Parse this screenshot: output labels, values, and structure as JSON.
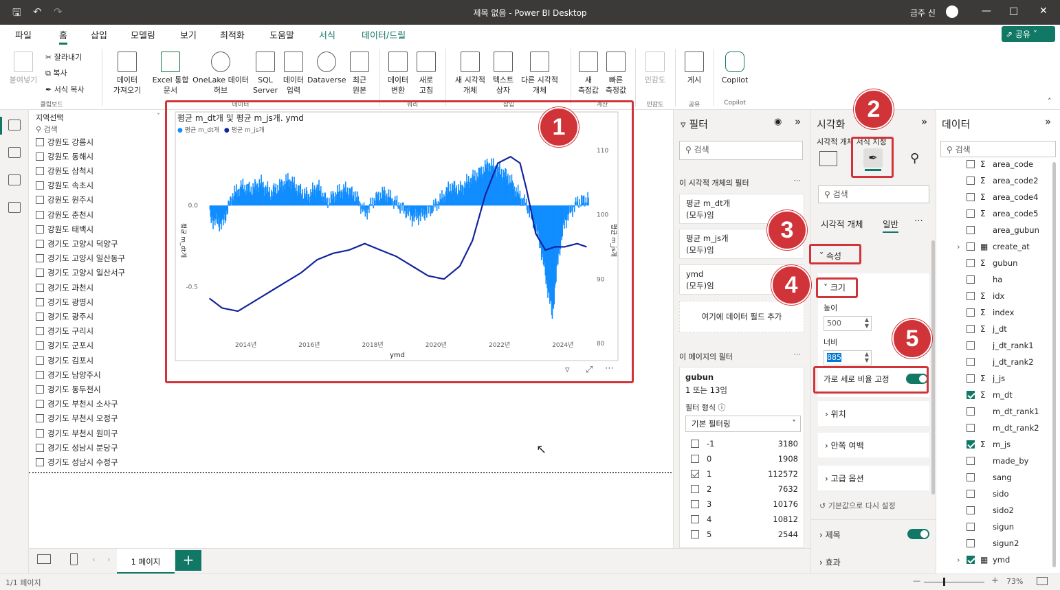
{
  "window": {
    "title": "제목 없음 - Power BI Desktop",
    "user": "금주 신"
  },
  "menu": {
    "tabs": [
      "파일",
      "홈",
      "삽입",
      "모델링",
      "보기",
      "최적화",
      "도움말",
      "서식",
      "데이터/드릴"
    ],
    "active": "홈",
    "share": "공유"
  },
  "ribbon": {
    "clipboard": {
      "paste": "붙여넣기",
      "cut": "잘라내기",
      "copy": "복사",
      "format_copy": "서식 복사",
      "group": "클립보드"
    },
    "data": {
      "get_data": [
        "데이터",
        "가져오기"
      ],
      "excel": [
        "Excel 통합",
        "문서"
      ],
      "onelake": [
        "OneLake 데이터",
        "허브"
      ],
      "sql": [
        "SQL",
        "Server"
      ],
      "enter": [
        "데이터",
        "입력"
      ],
      "dataverse": "Dataverse",
      "recent": [
        "최근",
        "원본"
      ],
      "group": "데이터"
    },
    "query": {
      "transform": [
        "데이터",
        "변환"
      ],
      "refresh": [
        "새로",
        "고침"
      ],
      "group": "쿼리"
    },
    "insert": {
      "new_visual": [
        "새 시각적",
        "개체"
      ],
      "textbox": [
        "텍스트",
        "상자"
      ],
      "more_visuals": [
        "다른 시각적",
        "개체"
      ],
      "group": "삽입"
    },
    "calc": {
      "new_measure": [
        "새",
        "측정값"
      ],
      "quick_measure": [
        "빠른",
        "측정값"
      ],
      "group": "계산"
    },
    "sensitivity": {
      "label": "민감도",
      "group": "민감도"
    },
    "share": {
      "publish": "게시",
      "group": "공유"
    },
    "copilot": {
      "label": "Copilot",
      "group": "Copilot"
    }
  },
  "slicer": {
    "header": "지역선택",
    "search_placeholder": "검색",
    "items": [
      "강원도 강릉시",
      "강원도 동해시",
      "강원도 삼척시",
      "강원도 속초시",
      "강원도 원주시",
      "강원도 춘천시",
      "강원도 태백시",
      "경기도 고양시 덕양구",
      "경기도 고양시 일산동구",
      "경기도 고양시 일산서구",
      "경기도 과천시",
      "경기도 광명시",
      "경기도 광주시",
      "경기도 구리시",
      "경기도 군포시",
      "경기도 김포시",
      "경기도 남양주시",
      "경기도 동두천시",
      "경기도 부천시 소사구",
      "경기도 부천시 오정구",
      "경기도 부천시 원미구",
      "경기도 성남시 분당구",
      "경기도 성남시 수정구"
    ]
  },
  "chart_data": {
    "type": "combo-bar-line",
    "title": "평균 m_dt개 및 평균 m_js개. ymd",
    "legend": [
      "평균 m_dt개",
      "평균 m_js개"
    ],
    "xlabel": "ymd",
    "ylabel_left": "평균 m_dt개",
    "ylabel_right": "평균 m_js개",
    "x_ticks": [
      "2014년",
      "2016년",
      "2018년",
      "2020년",
      "2022년",
      "2024년"
    ],
    "y_left_ticks": [
      "0.0",
      "-0.5"
    ],
    "y_right_ticks": [
      "110",
      "100",
      "90",
      "80"
    ],
    "ylim_left": [
      -0.85,
      0.42
    ],
    "ylim_right": [
      80,
      112
    ],
    "xlim": [
      2012.8,
      2024.9
    ],
    "series": [
      {
        "name": "평균 m_dt개",
        "kind": "bar",
        "color": "#118dff",
        "x": [
          2012.9,
          2013.3,
          2013.6,
          2013.9,
          2014.2,
          2014.5,
          2014.8,
          2015.1,
          2015.4,
          2015.7,
          2016.0,
          2016.3,
          2016.6,
          2016.9,
          2017.2,
          2017.5,
          2017.8,
          2018.1,
          2018.4,
          2018.7,
          2019.0,
          2019.3,
          2019.6,
          2019.9,
          2020.2,
          2020.5,
          2020.8,
          2021.1,
          2021.4,
          2021.7,
          2022.0,
          2022.3,
          2022.6,
          2022.9,
          2023.1,
          2023.3,
          2023.5,
          2023.7,
          2023.9,
          2024.1,
          2024.3,
          2024.5,
          2024.8
        ],
        "y": [
          -0.08,
          -0.12,
          0.06,
          0.12,
          0.1,
          0.14,
          0.08,
          0.12,
          0.16,
          0.1,
          0.06,
          0.12,
          0.02,
          0.08,
          0.1,
          0.06,
          -0.05,
          0.04,
          0.08,
          0.03,
          -0.02,
          -0.08,
          -0.06,
          -0.02,
          0.04,
          0.12,
          0.1,
          0.16,
          0.2,
          0.26,
          0.22,
          0.18,
          0.08,
          0.0,
          -0.1,
          -0.22,
          -0.45,
          -0.68,
          -0.3,
          -0.1,
          -0.03,
          0.02,
          0.04
        ]
      },
      {
        "name": "평균 m_js개",
        "kind": "line",
        "color": "#12239e",
        "x": [
          2012.9,
          2013.3,
          2013.8,
          2014.3,
          2014.8,
          2015.3,
          2015.8,
          2016.3,
          2016.8,
          2017.3,
          2017.8,
          2018.3,
          2018.8,
          2019.3,
          2019.8,
          2020.3,
          2020.8,
          2021.2,
          2021.6,
          2022.0,
          2022.4,
          2022.7,
          2022.9,
          2023.2,
          2023.5,
          2023.8,
          2024.1,
          2024.5,
          2024.8
        ],
        "y": [
          87,
          85.5,
          85,
          86.5,
          88,
          89.5,
          91,
          93,
          94,
          94.5,
          95.5,
          94.5,
          93.5,
          92,
          90.5,
          90,
          92,
          96,
          103,
          108,
          109,
          108,
          104,
          97,
          94.5,
          95,
          95,
          95.5,
          95
        ]
      }
    ]
  },
  "filters": {
    "title": "필터",
    "search_placeholder": "검색",
    "visual_section": "이 시각적 개체의 필터",
    "visual_filters": [
      {
        "name": "평균 m_dt개",
        "state": "(모두)임"
      },
      {
        "name": "평균 m_js개",
        "state": "(모두)임"
      },
      {
        "name": "ymd",
        "state": "(모두)임"
      }
    ],
    "add_field": "여기에 데이터 필드 추가",
    "page_section": "이 페이지의 필터",
    "gubun": {
      "name": "gubun",
      "state": "1 또는 13임",
      "type_label": "필터 형식",
      "type_value": "기본 필터링",
      "rows": [
        {
          "v": "-1",
          "c": "3180",
          "on": false
        },
        {
          "v": "0",
          "c": "1908",
          "on": false
        },
        {
          "v": "1",
          "c": "112572",
          "on": true
        },
        {
          "v": "2",
          "c": "7632",
          "on": false
        },
        {
          "v": "3",
          "c": "10176",
          "on": false
        },
        {
          "v": "4",
          "c": "10812",
          "on": false
        },
        {
          "v": "5",
          "c": "2544",
          "on": false
        }
      ]
    }
  },
  "viz": {
    "title": "시각화",
    "subtitle": "시각적 개체 서식 지정",
    "search_placeholder": "검색",
    "tabs": [
      "시각적 개체",
      "일반"
    ],
    "properties": "속성",
    "size": "크기",
    "height_label": "높이",
    "height_value": "500",
    "width_label": "너비",
    "width_value": "885",
    "lock_aspect": "가로 세로 비율 고정",
    "position": "위치",
    "padding": "안쪽 여백",
    "advanced": "고급 옵션",
    "reset": "기본값으로 다시 설정",
    "title_section": "제목",
    "effects": "효과"
  },
  "datapane": {
    "title": "데이터",
    "search_placeholder": "검색",
    "fields": [
      {
        "name": "area_code",
        "sigma": true,
        "checked": false
      },
      {
        "name": "area_code2",
        "sigma": true,
        "checked": false
      },
      {
        "name": "area_code4",
        "sigma": true,
        "checked": false
      },
      {
        "name": "area_code5",
        "sigma": true,
        "checked": false
      },
      {
        "name": "area_gubun",
        "sigma": false,
        "checked": false
      },
      {
        "name": "create_at",
        "sigma": false,
        "checked": false,
        "date": true
      },
      {
        "name": "gubun",
        "sigma": true,
        "checked": false
      },
      {
        "name": "ha",
        "sigma": false,
        "checked": false
      },
      {
        "name": "idx",
        "sigma": true,
        "checked": false
      },
      {
        "name": "index",
        "sigma": true,
        "checked": false
      },
      {
        "name": "j_dt",
        "sigma": true,
        "checked": false
      },
      {
        "name": "j_dt_rank1",
        "sigma": false,
        "checked": false
      },
      {
        "name": "j_dt_rank2",
        "sigma": false,
        "checked": false
      },
      {
        "name": "j_js",
        "sigma": true,
        "checked": false
      },
      {
        "name": "m_dt",
        "sigma": true,
        "checked": true
      },
      {
        "name": "m_dt_rank1",
        "sigma": false,
        "checked": false
      },
      {
        "name": "m_dt_rank2",
        "sigma": false,
        "checked": false
      },
      {
        "name": "m_js",
        "sigma": true,
        "checked": true
      },
      {
        "name": "made_by",
        "sigma": false,
        "checked": false
      },
      {
        "name": "sang",
        "sigma": false,
        "checked": false
      },
      {
        "name": "sido",
        "sigma": false,
        "checked": false
      },
      {
        "name": "sido2",
        "sigma": false,
        "checked": false
      },
      {
        "name": "sigun",
        "sigma": false,
        "checked": false
      },
      {
        "name": "sigun2",
        "sigma": false,
        "checked": false
      },
      {
        "name": "ymd",
        "sigma": false,
        "checked": true,
        "date": true
      }
    ]
  },
  "pages": {
    "current": "1 페이지",
    "add": "+"
  },
  "status": {
    "page_count": "1/1 페이지",
    "zoom": "73%"
  },
  "badges": [
    "1",
    "2",
    "3",
    "4",
    "5"
  ],
  "colors": {
    "accent": "#117865",
    "highlight": "#d13438",
    "bar": "#118dff",
    "line": "#12239e"
  }
}
